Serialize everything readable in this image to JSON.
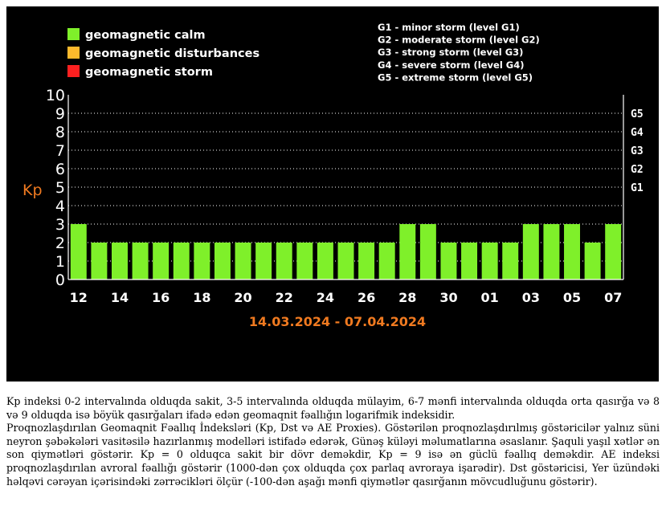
{
  "legend": [
    {
      "label": "geomagnetic calm",
      "color": "#7ff02a"
    },
    {
      "label": "geomagnetic disturbances",
      "color": "#fcb92c"
    },
    {
      "label": "geomagnetic storm",
      "color": "#fc2020"
    }
  ],
  "storm_levels": [
    "G1 - minor storm (level G1)",
    "G2 - moderate storm (level G2)",
    "G3 - strong storm (level G3)",
    "G4 - severe storm (level G4)",
    "G5 - extreme storm (level G5)"
  ],
  "colors": {
    "background": "#000000",
    "bar_calm": "#7ff02a",
    "grid": "#ffffff",
    "axis_text": "#ffffff",
    "accent": "#f07a20"
  },
  "chart_data": {
    "type": "bar",
    "ylabel": "Kp",
    "ylim": [
      0,
      10
    ],
    "yticks": [
      "0",
      "1",
      "2",
      "3",
      "4",
      "5",
      "6",
      "7",
      "8",
      "9",
      "10"
    ],
    "right_ticks": [
      {
        "label": "G1",
        "value": 5
      },
      {
        "label": "G2",
        "value": 6
      },
      {
        "label": "G3",
        "value": 7
      },
      {
        "label": "G4",
        "value": 8
      },
      {
        "label": "G5",
        "value": 9
      }
    ],
    "date_range": "14.03.2024 - 07.04.2024",
    "xtick_labels": [
      "12",
      "14",
      "16",
      "18",
      "20",
      "22",
      "24",
      "26",
      "28",
      "30",
      "01",
      "03",
      "05",
      "07"
    ],
    "values": [
      3,
      2,
      2,
      2,
      2,
      2,
      2,
      2,
      2,
      2,
      2,
      2,
      2,
      2,
      2,
      2,
      3,
      3,
      2,
      2,
      2,
      2,
      3,
      3,
      3,
      2,
      3
    ],
    "bar_color": "#7ff02a",
    "grid": true,
    "legend_position": "top-left"
  },
  "caption": {
    "paragraph1": "Kp indeksi 0-2 intervalında olduqda sakit, 3-5 intervalında olduqda mülayim, 6-7 mənfi intervalında olduqda orta qasırğa və 8 və 9 olduqda isə böyük qasırğaları ifadə edən geomaqnit fəallığın logarifmik indeksidir.",
    "paragraph2": "Proqnozlaşdırılan Geomaqnit Fəallıq İndeksləri (Kp, Dst və AE Proxies). Göstərilən proqnozlaşdırılmış göstəricilər yalnız süni neyron şəbəkələri vasitəsilə hazırlanmış modelləri istifadə edərək, Günəş küləyi məlumatlarına əsaslanır. Şaquli yaşıl xətlər ən son qiymətləri göstərir. Kp = 0 olduqca sakit bir dövr deməkdir, Kp = 9 isə ən güclü fəallıq deməkdir. AE indeksi proqnozlaşdırılan avroral fəallığı göstərir (1000-dən çox olduqda çox parlaq avroraya işarədir). Dst göstəricisi, Yer üzündəki həlqəvi cərəyan içərisindəki zərrəcikləri ölçür (-100-dən aşağı mənfi qiymətlər qasırğanın mövcudluğunu göstərir)."
  }
}
